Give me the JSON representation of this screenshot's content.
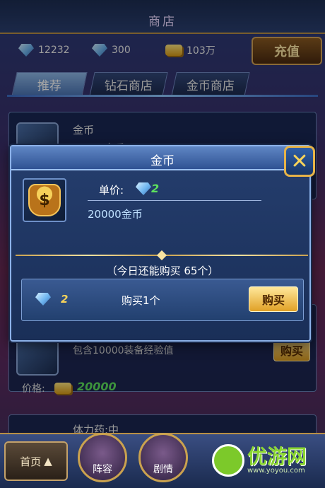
{
  "header": {
    "title": "商店"
  },
  "currency": {
    "diamond": "12232",
    "ticket": "300",
    "gold": "103万",
    "recharge_label": "充值"
  },
  "tabs": [
    {
      "label": "推荐",
      "active": true
    },
    {
      "label": "钻石商店",
      "active": false
    },
    {
      "label": "金币商店",
      "active": false
    }
  ],
  "list": {
    "items": [
      {
        "name": "金币",
        "desc": "20000金币"
      },
      {
        "name": "",
        "desc": "包含10000装备经验值",
        "price_label": "价格:",
        "price": "20000",
        "buy_label": "购买"
      },
      {
        "name": "体力药:中"
      }
    ]
  },
  "modal": {
    "title": "金币",
    "unit_price_label": "单价:",
    "unit_price": "2",
    "item_title": "20000金币",
    "remaining": "（今日还能购买 65个）",
    "qty_price": "2",
    "qty_label": "购买1个",
    "buy_label": "购买",
    "close_icon": "close-x"
  },
  "nav": {
    "home": "首页",
    "items": [
      "阵容",
      "剧情"
    ]
  },
  "watermark": {
    "text": "优游网",
    "url": "www.yoyou.com"
  }
}
